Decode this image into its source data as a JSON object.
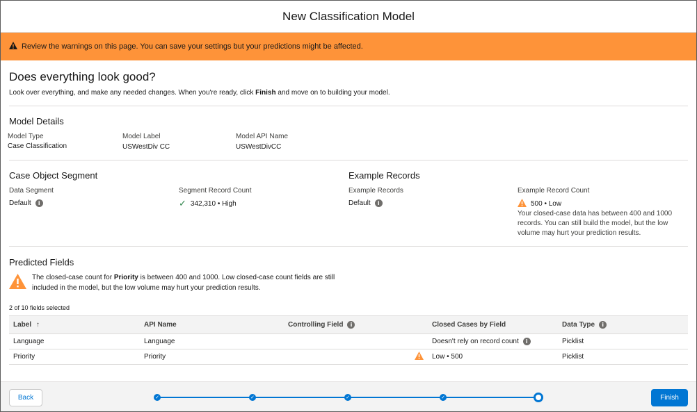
{
  "modal": {
    "title": "New Classification Model"
  },
  "banner": {
    "text": "Review the warnings on this page. You can save your settings but your predictions might be affected."
  },
  "intro": {
    "title": "Does everything look good?",
    "text_before": "Look over everything, and make any needed changes. When you're ready, click ",
    "text_bold": "Finish",
    "text_after": " and move on to building your model."
  },
  "model_details": {
    "title": "Model Details",
    "type_label": "Model Type",
    "type_value": "Case Classification",
    "label_label": "Model Label",
    "label_value": "USWestDiv CC",
    "api_label": "Model API Name",
    "api_value": "USWestDivCC"
  },
  "segment": {
    "title": "Case Object Segment",
    "data_segment_label": "Data Segment",
    "data_segment_value": "Default",
    "count_label": "Segment Record Count",
    "count_value": "342,310 • High"
  },
  "examples": {
    "title": "Example Records",
    "records_label": "Example Records",
    "records_value": "Default",
    "count_label": "Example Record Count",
    "count_value": "500 • Low",
    "note": "Your closed-case data has between 400 and 1000 records. You can still build the model, but the low volume may hurt your prediction results."
  },
  "predicted": {
    "title": "Predicted Fields",
    "warning_before": "The closed-case count for ",
    "warning_bold": "Priority",
    "warning_after": " is between 400 and 1000. Low closed-case count fields are still included in the model, but the low volume may hurt your prediction results.",
    "selected": "2 of 10 fields selected",
    "columns": {
      "label": "Label",
      "sort_arrow": "↑",
      "api": "API Name",
      "controlling": "Controlling Field",
      "closed": "Closed Cases by Field",
      "type": "Data Type"
    },
    "rows": [
      {
        "label": "Language",
        "api": "Language",
        "controlling": "",
        "closed": "Doesn't rely on record count",
        "type": "Picklist"
      },
      {
        "label": "Priority",
        "api": "Priority",
        "controlling": "",
        "closed": "Low • 500",
        "type": "Picklist"
      }
    ]
  },
  "footer": {
    "back": "Back",
    "finish": "Finish",
    "steps_total": 5,
    "current_step": 5
  },
  "colors": {
    "banner": "#fe9339",
    "brand": "#0176d3",
    "success": "#2e844a",
    "warning": "#fe9339"
  },
  "icons": {
    "warning": "warning-icon",
    "info": "info-icon",
    "check": "check-icon",
    "sort": "arrow-up-icon"
  }
}
